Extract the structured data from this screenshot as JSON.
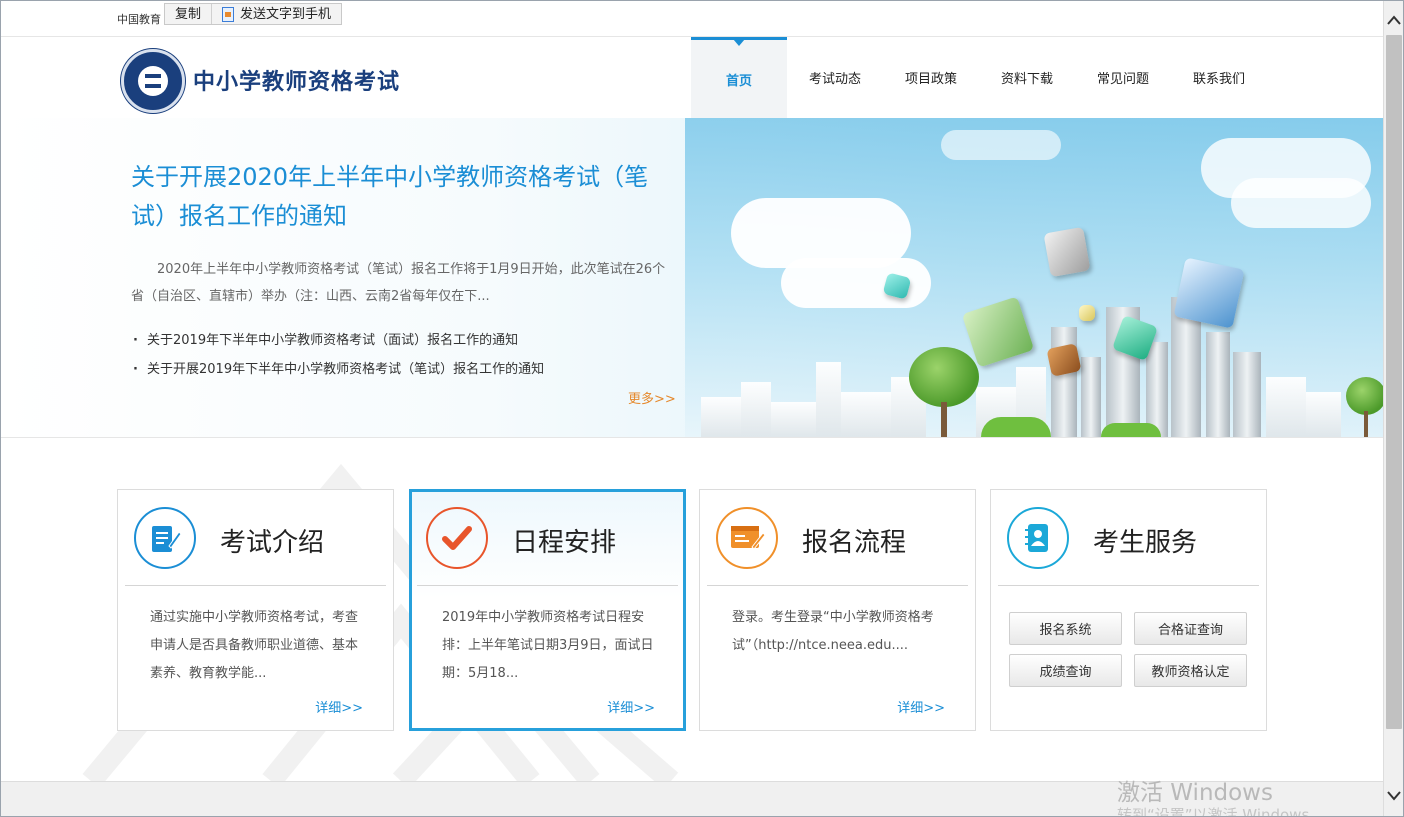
{
  "topbar": {
    "site_prefix": "中国教育",
    "context_menu": {
      "copy": "复制",
      "send": "发送文字到手机"
    }
  },
  "header": {
    "brand": "中小学教师资格考试",
    "nav": [
      "首页",
      "考试动态",
      "项目政策",
      "资料下载",
      "常见问题",
      "联系我们"
    ],
    "active_nav": "首页"
  },
  "banner": {
    "headline": "关于开展2020年上半年中小学教师资格考试（笔试）报名工作的通知",
    "summary": "2020年上半年中小学教师资格考试（笔试）报名工作将于1月9日开始，此次笔试在26个省（自治区、直辖市）举办（注：山西、云南2省每年仅在下...",
    "links": [
      "关于2019年下半年中小学教师资格考试（面试）报名工作的通知",
      "关于开展2019年下半年中小学教师资格考试（笔试）报名工作的通知"
    ],
    "more": "更多>>"
  },
  "cards": [
    {
      "title": "考试介绍",
      "body": "通过实施中小学教师资格考试，考查申请人是否具备教师职业道德、基本素养、教育教学能...",
      "detail": "详细>>",
      "icon": "document-pen-icon",
      "color": "#1b8ed5"
    },
    {
      "title": "日程安排",
      "body": "2019年中小学教师资格考试日程安排：上半年笔试日期3月9日，面试日期：5月18...",
      "detail": "详细>>",
      "icon": "checkmark-icon",
      "color": "#e8552b"
    },
    {
      "title": "报名流程",
      "body": "登录。考生登录“中小学教师资格考试”（http://ntce.neea.edu....",
      "detail": "详细>>",
      "icon": "form-edit-icon",
      "color": "#f0902a"
    },
    {
      "title": "考生服务",
      "buttons": [
        "报名系统",
        "合格证查询",
        "成绩查询",
        "教师资格认定"
      ],
      "icon": "contact-book-icon",
      "color": "#1ba8d8"
    }
  ],
  "watermark": {
    "line1": "激活 Windows",
    "line2": "转到“设置”以激活 Windows。"
  }
}
